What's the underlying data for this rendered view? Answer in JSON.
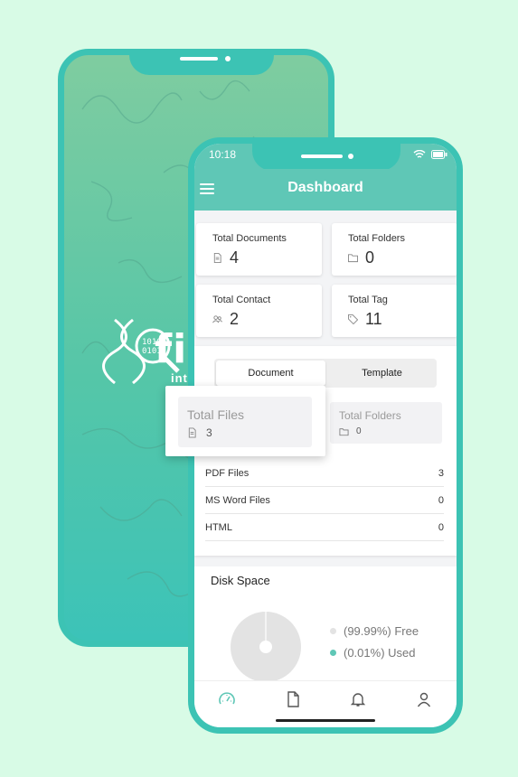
{
  "splash": {
    "brand_text": "fil",
    "brand_sub": "inte"
  },
  "status_bar": {
    "time": "10:18"
  },
  "header": {
    "title": "Dashboard"
  },
  "stats": {
    "total_documents": {
      "label": "Total Documents",
      "value": "4"
    },
    "total_folders": {
      "label": "Total Folders",
      "value": "0"
    },
    "total_contact": {
      "label": "Total Contact",
      "value": "2"
    },
    "total_tag": {
      "label": "Total Tag",
      "value": "11"
    }
  },
  "tabs": {
    "items": [
      {
        "label": "Document"
      },
      {
        "label": "Template"
      }
    ],
    "active": "Document"
  },
  "popup": {
    "label": "Total Files",
    "value": "3"
  },
  "sub_card": {
    "label": "Total Folders",
    "value": "0"
  },
  "file_rows": [
    {
      "label": "PDF Files",
      "value": "3"
    },
    {
      "label": "MS Word Files",
      "value": "0"
    },
    {
      "label": "HTML",
      "value": "0"
    }
  ],
  "disk": {
    "title": "Disk Space",
    "legend": [
      {
        "text": "(99.99%)  Free",
        "color": "#e3e3e3"
      },
      {
        "text": "(0.01%)  Used",
        "color": "#5fc7b6"
      }
    ]
  },
  "colors": {
    "accent": "#5fc7b6",
    "frame": "#3cc3b4",
    "background": "#d8fbe6"
  },
  "bottom_nav": {
    "icons": [
      "dashboard-gauge-icon",
      "document-icon",
      "bell-icon",
      "user-icon"
    ]
  }
}
